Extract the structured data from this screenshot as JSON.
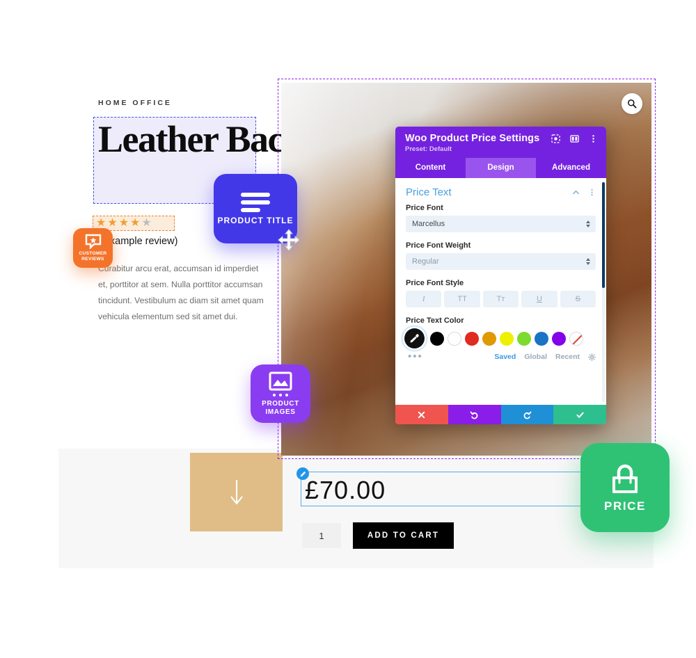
{
  "page": {
    "eyebrow": "HOME OFFICE",
    "product_title": "Leather Backpack",
    "stars_filled": "★★★★",
    "stars_empty": "★",
    "review_label": "(example review)",
    "description": "Curabitur arcu erat, accumsan id imperdiet et, porttitor at sem. Nulla porttitor accumsan tincidunt. Vestibulum ac diam sit amet quam vehicula elementum sed sit amet dui.",
    "price": "£70.00",
    "quantity": "1",
    "add_to_cart": "ADD TO CART",
    "search_icon": "search-icon",
    "edit_icon": "pencil-edit-icon",
    "scroll_arrow_icon": "arrow-down-icon"
  },
  "modal": {
    "title": "Woo Product Price Settings",
    "preset": "Preset: Default",
    "header_icons": [
      "focus-target-icon",
      "layout-columns-icon",
      "vertical-dots-icon"
    ],
    "tabs": [
      {
        "label": "Content",
        "active": false
      },
      {
        "label": "Design",
        "active": true
      },
      {
        "label": "Advanced",
        "active": false
      }
    ],
    "section": {
      "title": "Price Text",
      "collapse_icon": "chevron-up-icon",
      "menu_icon": "vertical-dots-icon"
    },
    "fields": [
      {
        "label": "Price Font",
        "value": "Marcellus",
        "muted": false
      },
      {
        "label": "Price Font Weight",
        "value": "Regular",
        "muted": true
      }
    ],
    "font_style": {
      "label": "Price Font Style",
      "buttons": [
        {
          "name": "italic-button",
          "glyph": "I"
        },
        {
          "name": "uppercase-button",
          "glyph": "TT"
        },
        {
          "name": "capitalize-button",
          "glyph": "Tт"
        },
        {
          "name": "underline-button",
          "glyph": "U"
        },
        {
          "name": "strikethrough-button",
          "glyph": "S"
        }
      ]
    },
    "color": {
      "label": "Price Text Color",
      "picker_icon": "eyedropper-icon",
      "swatches": [
        {
          "name": "black",
          "hex": "#000000"
        },
        {
          "name": "white",
          "hex": "#ffffff"
        },
        {
          "name": "red",
          "hex": "#e02b20"
        },
        {
          "name": "orange",
          "hex": "#e09900"
        },
        {
          "name": "yellow",
          "hex": "#edf000"
        },
        {
          "name": "green",
          "hex": "#7cdb2e"
        },
        {
          "name": "blue",
          "hex": "#1a73c4"
        },
        {
          "name": "purple",
          "hex": "#8300e9"
        },
        {
          "name": "none",
          "hex": "transparent"
        }
      ],
      "more_icon": "ellipsis-icon",
      "tabs": [
        {
          "label": "Saved",
          "active": true
        },
        {
          "label": "Global",
          "active": false
        },
        {
          "label": "Recent",
          "active": false
        }
      ],
      "settings_icon": "gear-icon"
    },
    "footer_buttons": [
      {
        "name": "cancel-button",
        "icon": "close-icon",
        "color": "#f0544f"
      },
      {
        "name": "undo-button",
        "icon": "undo-icon",
        "color": "#8a1ee8"
      },
      {
        "name": "redo-button",
        "icon": "redo-icon",
        "color": "#1f8fd6"
      },
      {
        "name": "save-button",
        "icon": "check-icon",
        "color": "#2ebf8f"
      }
    ]
  },
  "badges": [
    {
      "name": "product-title-badge",
      "label": "PRODUCT TITLE",
      "color": "#4338e8",
      "icon": "text-lines-icon"
    },
    {
      "name": "product-images-badge",
      "label": "PRODUCT IMAGES",
      "color": "#8a3df0",
      "icon": "image-icon"
    },
    {
      "name": "customer-reviews-badge",
      "label": "CUSTOMER REVIEWS",
      "color": "#f4732a",
      "icon": "review-star-bubble-icon"
    },
    {
      "name": "price-badge",
      "label": "PRICE",
      "color": "#2fc275",
      "icon": "shopping-bag-icon"
    }
  ]
}
